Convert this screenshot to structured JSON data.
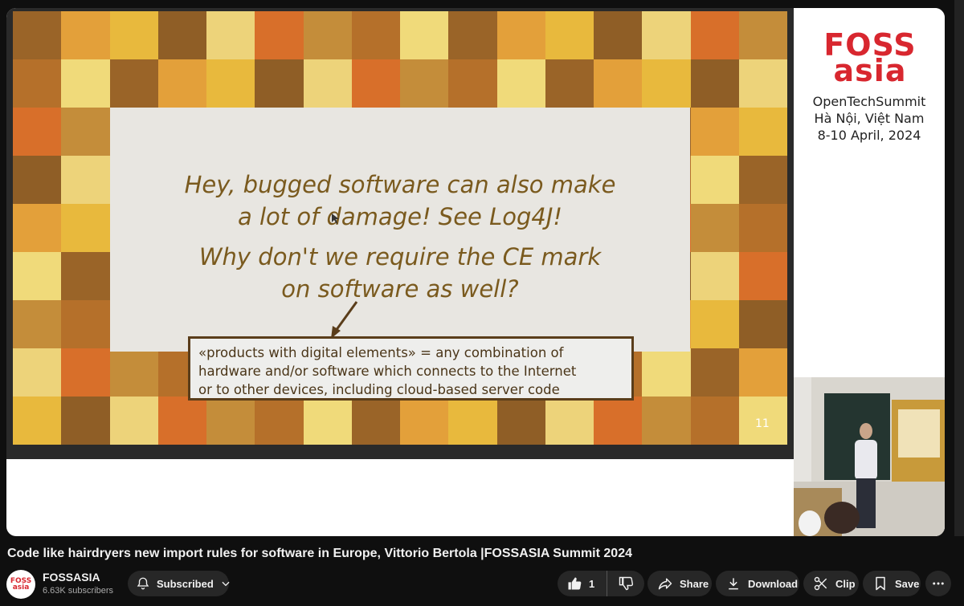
{
  "slide": {
    "line1": "Hey, bugged software can also make",
    "line2": "a lot of damage! See Log4J!",
    "line3": "Why don't we require the CE mark",
    "line4": "on software as well?",
    "callout_line1": "«products with digital elements» = any combination of",
    "callout_line2": "hardware and/or software which connects to the Internet",
    "callout_line3": "or to other devices, including cloud-based server code",
    "page_number": "11"
  },
  "sidebar_branding": {
    "logo_line1": "FOSS",
    "logo_line2": "asia",
    "event_line1": "OpenTechSummit",
    "event_line2": "Hà Nội, Việt Nam",
    "event_line3": "8-10 April, 2024"
  },
  "video": {
    "title": "Code like hairdryers new import rules for software in Europe, Vittorio Bertola |FOSSASIA Summit 2024"
  },
  "channel": {
    "name": "FOSSASIA",
    "subscribers": "6.63K subscribers",
    "avatar_line1": "FOSS",
    "avatar_line2": "asia"
  },
  "actions": {
    "subscribe_label": "Subscribed",
    "like_count": "1",
    "share_label": "Share",
    "download_label": "Download",
    "clip_label": "Clip",
    "save_label": "Save"
  },
  "colors": {
    "brand_red": "#d8272f",
    "slide_text": "#7a5a1e",
    "background": "#0f0f0f",
    "pill": "#272727"
  }
}
